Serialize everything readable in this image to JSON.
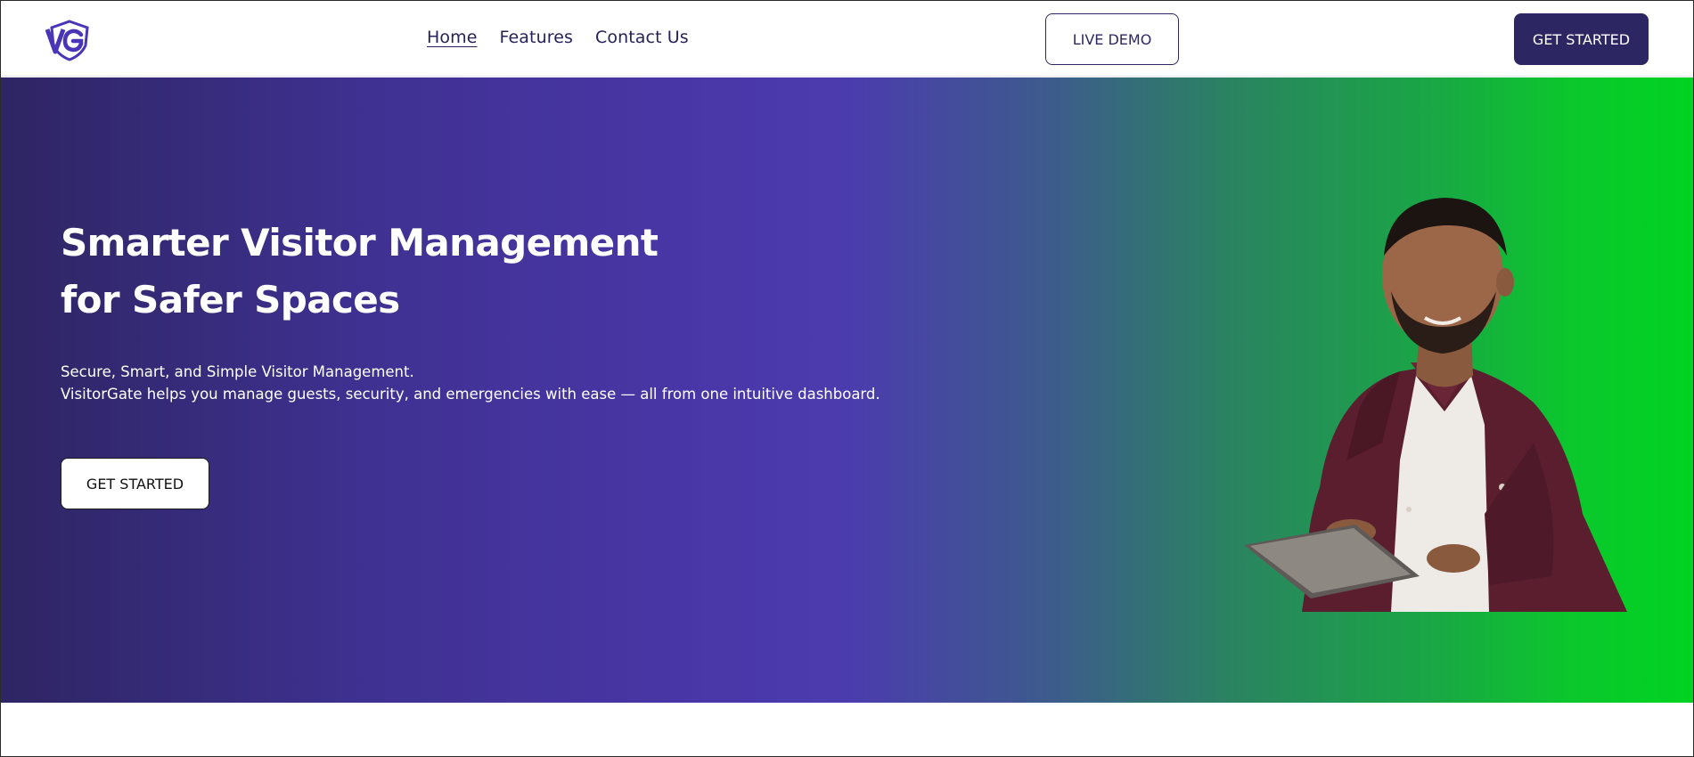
{
  "header": {
    "logo_text": "VG",
    "nav": [
      {
        "label": "Home",
        "active": true
      },
      {
        "label": "Features",
        "active": false
      },
      {
        "label": "Contact Us",
        "active": false
      }
    ],
    "live_demo_label": "LIVE DEMO",
    "get_started_label": "GET STARTED"
  },
  "hero": {
    "title_line1": "Smarter Visitor Management",
    "title_line2": "for Safer Spaces",
    "subtitle_line1": "Secure, Smart, and Simple Visitor Management.",
    "subtitle_line2": "VisitorGate helps you manage guests, security, and emergencies with ease — all from one intuitive dashboard.",
    "cta_label": "GET STARTED"
  },
  "colors": {
    "brand": "#2c2663",
    "accent_purple": "#4b3cae",
    "accent_green": "#00d322",
    "logo": "#4a35b8"
  },
  "icons": {
    "logo": "shield-logo-icon",
    "hero_image": "man-with-tablet-illustration"
  }
}
